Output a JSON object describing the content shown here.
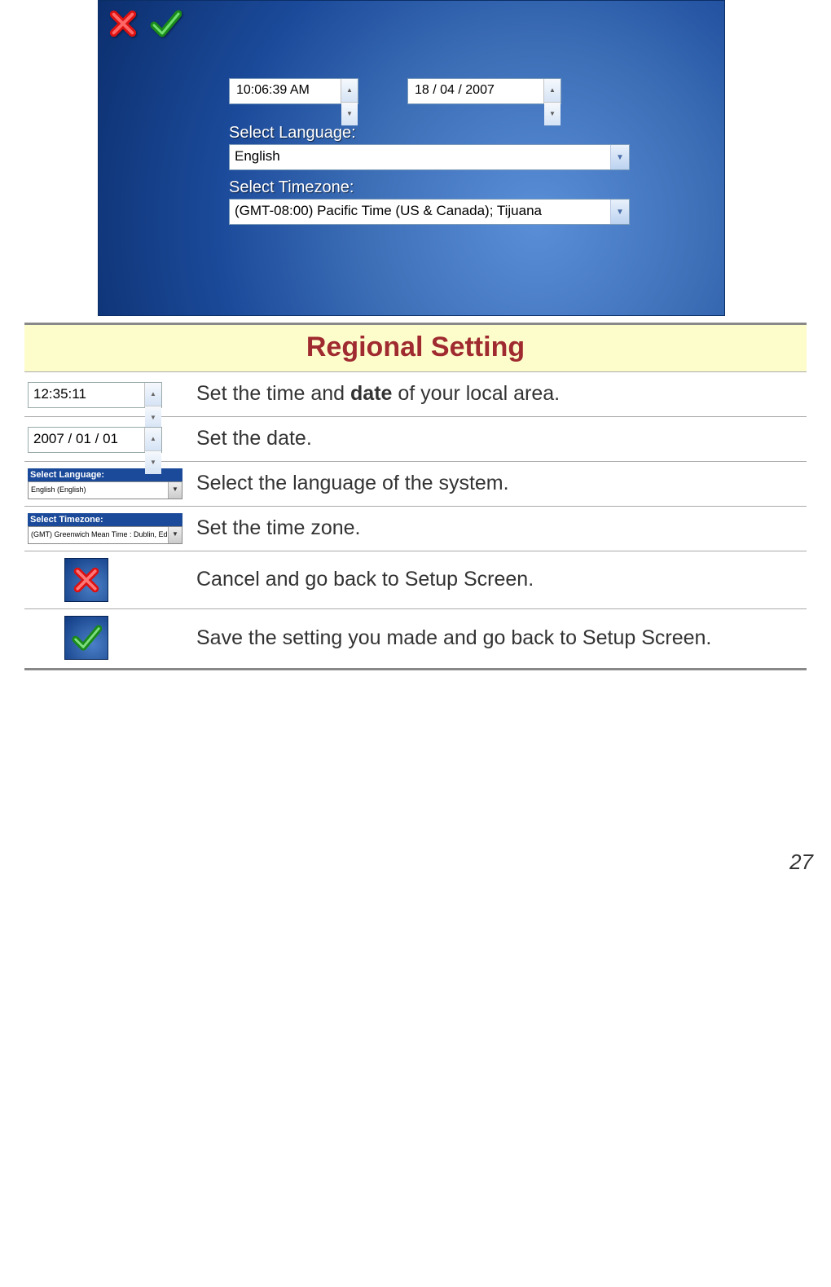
{
  "shot": {
    "time_value": "10:06:39 AM",
    "date_value": "18 / 04 / 2007",
    "lang_label": "Select Language:",
    "lang_value": "English",
    "tz_label": "Select Timezone:",
    "tz_value": "(GMT-08:00) Pacific Time (US & Canada); Tijuana"
  },
  "table": {
    "title": "Regional Setting",
    "rows": {
      "time": {
        "value": "12:35:11",
        "desc_pre": "Set the time and ",
        "desc_bold": "date",
        "desc_post": " of your local area."
      },
      "date": {
        "value": "2007 / 01 / 01",
        "desc": "Set the date."
      },
      "lang": {
        "title": "Select Language:",
        "value": "English (English)",
        "desc": "Select the language of the system."
      },
      "tz": {
        "title": "Select Timezone:",
        "value": "(GMT) Greenwich Mean Time : Dublin, Edinburgh, Lisbon, Londo",
        "desc": "Set the time zone."
      },
      "cancel": {
        "desc": "Cancel and go back to Setup Screen."
      },
      "save": {
        "desc": "Save the setting you made and go back to Setup Screen."
      }
    }
  },
  "page_number": "27"
}
